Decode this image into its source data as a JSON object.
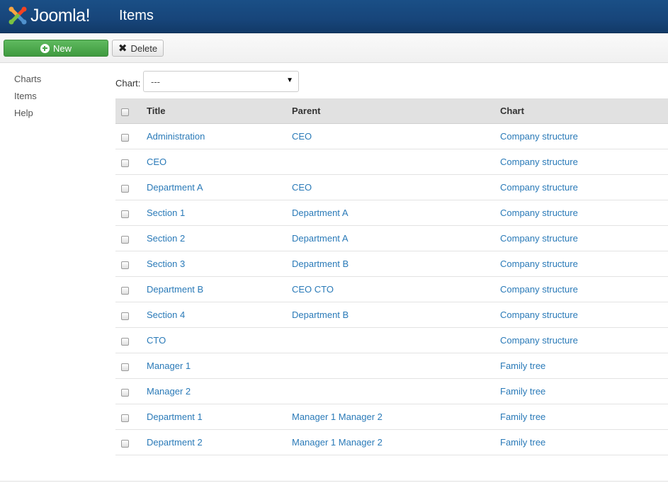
{
  "brand": {
    "name": "Joomla!",
    "colors": {
      "header": "#17457a",
      "new_button": "#4aa64a",
      "link": "#2a7ab8"
    }
  },
  "header": {
    "title": "Items"
  },
  "toolbar": {
    "new_label": "New",
    "new_icon": "plus-circle-icon",
    "delete_label": "Delete",
    "delete_icon": "x-icon"
  },
  "sidebar": {
    "items": [
      {
        "label": "Charts"
      },
      {
        "label": "Items"
      },
      {
        "label": "Help"
      }
    ]
  },
  "filter": {
    "label": "Chart:",
    "selected": "---"
  },
  "table": {
    "columns": {
      "title": "Title",
      "parent": "Parent",
      "chart": "Chart"
    },
    "rows": [
      {
        "title": "Administration",
        "parent": "CEO",
        "chart": "Company structure"
      },
      {
        "title": "CEO",
        "parent": "",
        "chart": "Company structure"
      },
      {
        "title": "Department A",
        "parent": "CEO",
        "chart": "Company structure"
      },
      {
        "title": "Section 1",
        "parent": "Department A",
        "chart": "Company structure"
      },
      {
        "title": "Section 2",
        "parent": "Department A",
        "chart": "Company structure"
      },
      {
        "title": "Section 3",
        "parent": "Department B",
        "chart": "Company structure"
      },
      {
        "title": "Department B",
        "parent": "CEO CTO",
        "chart": "Company structure"
      },
      {
        "title": "Section 4",
        "parent": "Department B",
        "chart": "Company structure"
      },
      {
        "title": "CTO",
        "parent": "",
        "chart": "Company structure"
      },
      {
        "title": "Manager 1",
        "parent": "",
        "chart": "Family tree"
      },
      {
        "title": "Manager 2",
        "parent": "",
        "chart": "Family tree"
      },
      {
        "title": "Department 1",
        "parent": "Manager 1 Manager 2",
        "chart": "Family tree"
      },
      {
        "title": "Department 2",
        "parent": "Manager 1 Manager 2",
        "chart": "Family tree"
      }
    ]
  }
}
